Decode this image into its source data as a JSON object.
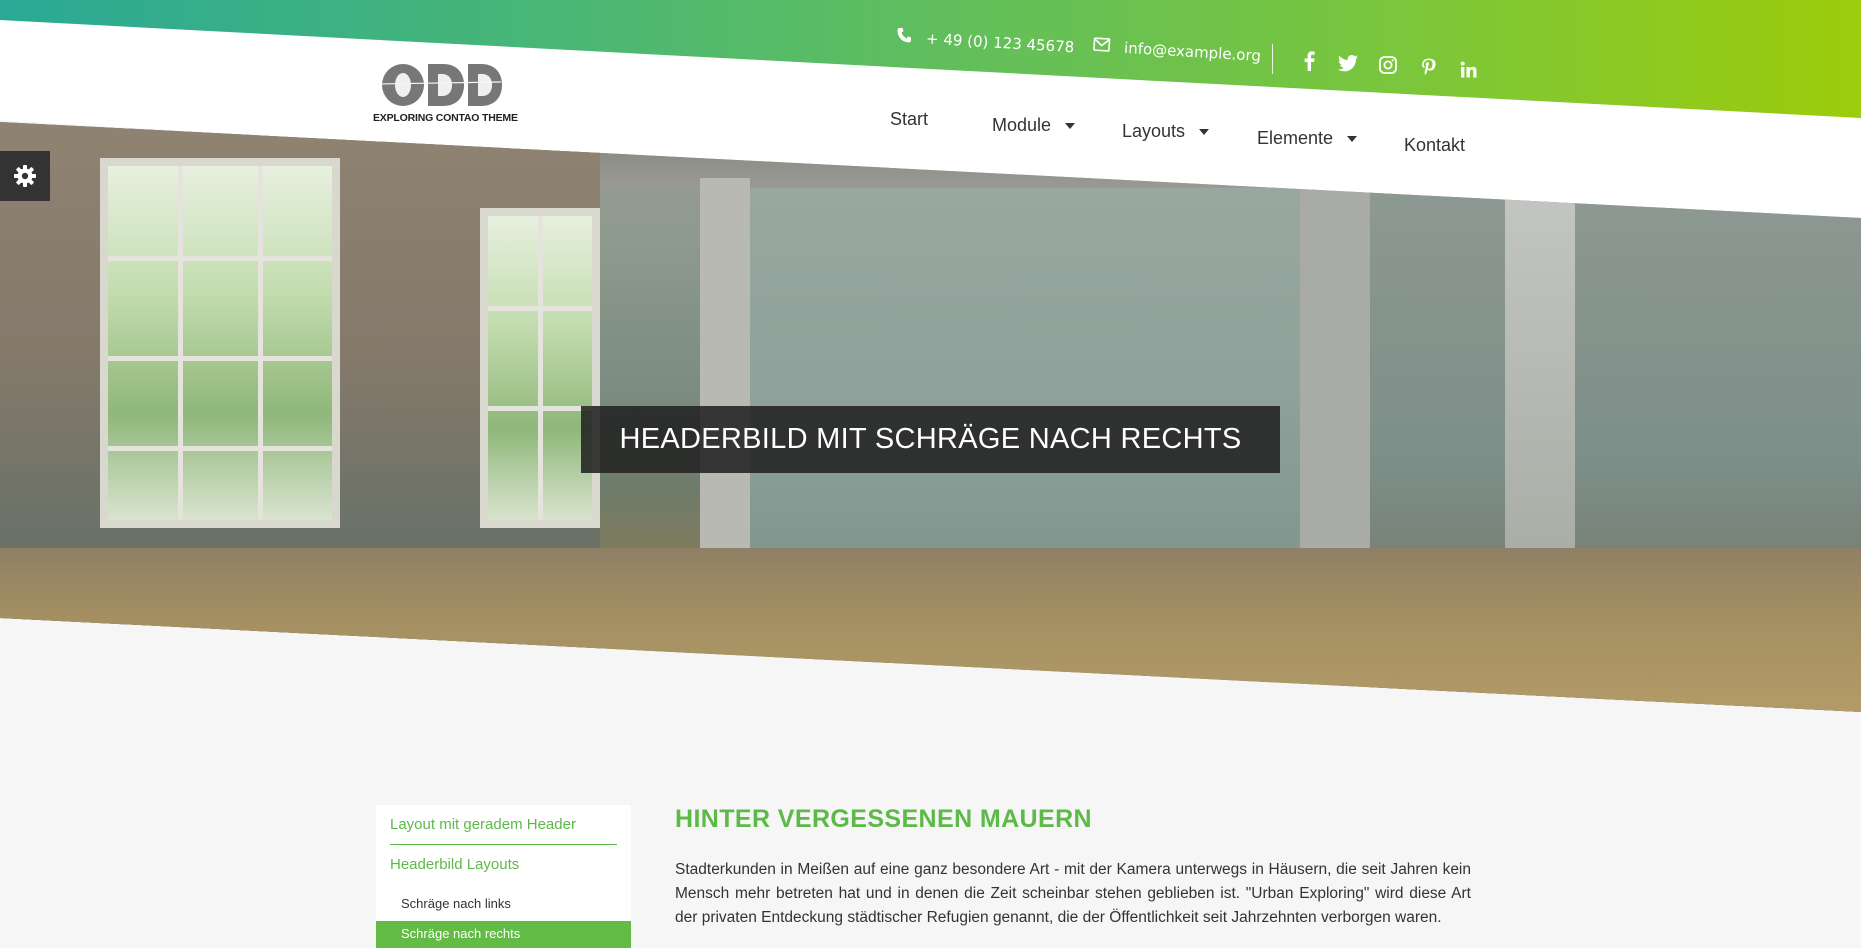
{
  "topbar": {
    "phone": "+ 49 (0) 123 45678",
    "email": "info@example.org",
    "social": [
      "facebook-icon",
      "twitter-icon",
      "instagram-icon",
      "pinterest-icon",
      "linkedin-icon"
    ]
  },
  "logo": {
    "text": "ODD",
    "tagline": "EXPLORING CONTAO THEME"
  },
  "nav": {
    "items": [
      {
        "label": "Start"
      },
      {
        "label": "Module"
      },
      {
        "label": "Layouts"
      },
      {
        "label": "Elemente"
      },
      {
        "label": "Kontakt"
      }
    ]
  },
  "hero": {
    "caption": "HEADERBILD MIT SCHRÄGE NACH RECHTS"
  },
  "sidebar": {
    "links": [
      {
        "label": "Layout mit geradem Header"
      },
      {
        "label": "Headerbild Layouts"
      }
    ],
    "sub": [
      {
        "label": "Schräge nach links"
      },
      {
        "label": "Schräge nach rechts"
      }
    ]
  },
  "main": {
    "title": "HINTER VERGESSENEN MAUERN",
    "text": "Stadterkunden in Meißen auf eine ganz besondere Art - mit der Kamera unterwegs in Häusern, die seit Jahren kein Mensch mehr betreten hat und in denen die Zeit scheinbar stehen geblieben ist. \"Urban Exploring\" wird diese Art der privaten Entdeckung städtischer Refugien genannt, die der Öffentlichkeit seit Jahrzehnten verborgen waren."
  },
  "colors": {
    "accent": "#5dba48",
    "gradient_start": "#2aa996",
    "gradient_end": "#9dcc0a",
    "caption_bg": "#222222"
  }
}
